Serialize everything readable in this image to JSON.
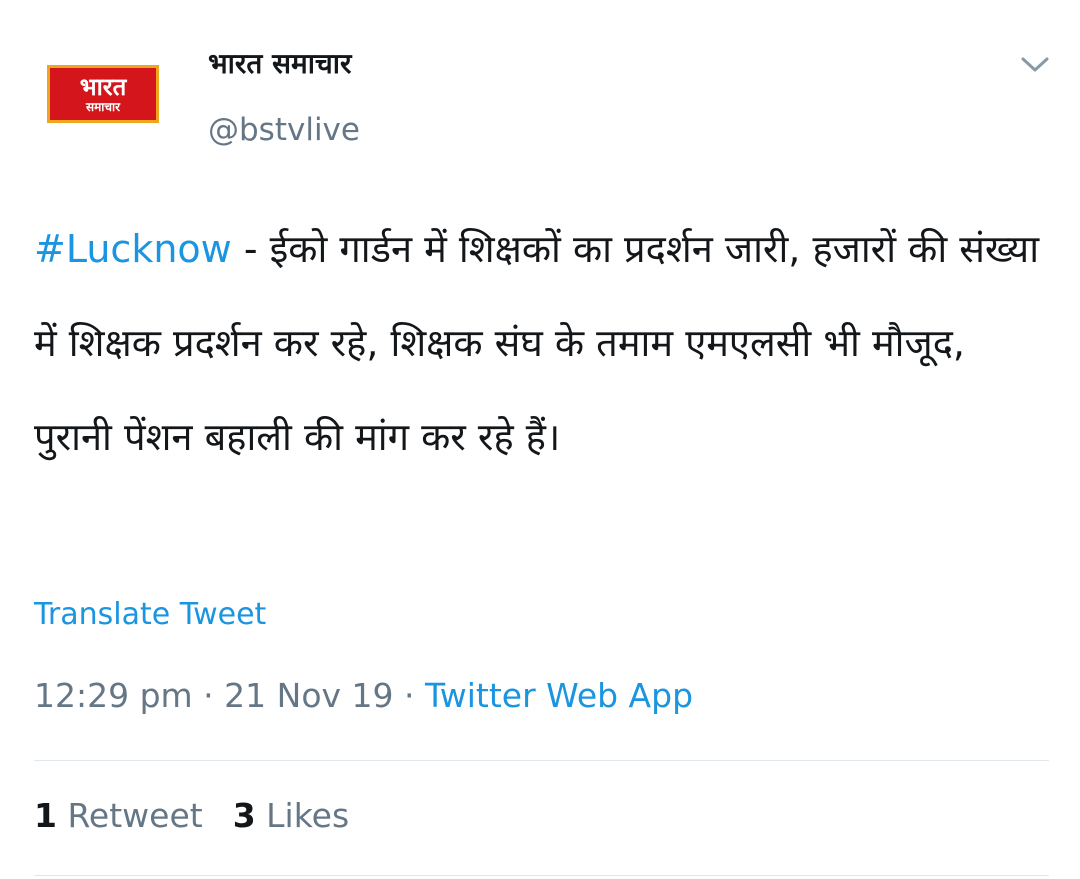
{
  "avatar": {
    "line1": "भारत",
    "line2": "समाचार",
    "colors": {
      "background": "#d4151b",
      "border": "#f0a51e",
      "text": "#ffffff"
    }
  },
  "user": {
    "display_name": "भारत समाचार",
    "handle": "@bstvlive"
  },
  "menu": {
    "icon": "chevron-down-icon"
  },
  "tweet": {
    "hashtag": "#Lucknow",
    "text": " - ईको गार्डन में शिक्षकों का प्रदर्शन जारी, हजारों की संख्या में शिक्षक प्रदर्शन कर रहे, शिक्षक संघ के तमाम एमएलसी भी मौजूद, पुरानी पेंशन बहाली की मांग कर रहे हैं।"
  },
  "translate_label": "Translate Tweet",
  "meta": {
    "time": "12:29 pm",
    "separator": " · ",
    "date": "21 Nov 19",
    "source": "Twitter Web App"
  },
  "stats": {
    "retweets_count": "1",
    "retweets_label": "Retweet",
    "likes_count": "3",
    "likes_label": "Likes"
  },
  "colors": {
    "link": "#1b95e0",
    "secondary_text": "#657786",
    "primary_text": "#14171a",
    "divider": "#e1e8ed"
  }
}
